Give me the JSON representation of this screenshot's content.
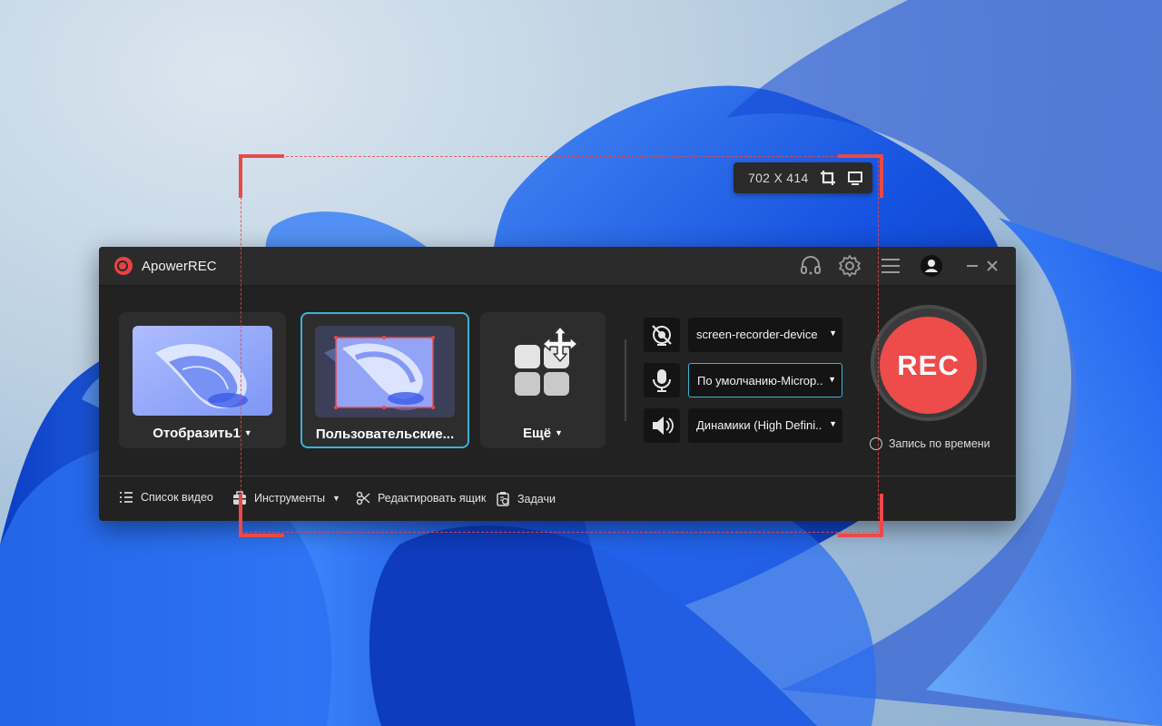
{
  "selection": {
    "dimensions": "702 X 414",
    "crop_icon": "crop-icon",
    "fullscreen_icon": "monitor-icon"
  },
  "app": {
    "title": "ApowerREC",
    "titlebar_icons": [
      "headset-icon",
      "gear-icon",
      "menu-icon",
      "avatar-icon",
      "minimize-icon",
      "close-icon"
    ]
  },
  "modes": {
    "display": {
      "label": "Отобразить1"
    },
    "custom": {
      "label": "Пользовательские..."
    },
    "more": {
      "label": "Ещё"
    }
  },
  "sources": {
    "camera": {
      "value": "screen-recorder-device",
      "icon": "camera-off-icon"
    },
    "microphone": {
      "value": "По умолчанию-Microp...",
      "icon": "microphone-icon"
    },
    "speaker": {
      "value": "Динамики (High Defini...",
      "icon": "speaker-icon"
    }
  },
  "rec": {
    "button_label": "REC",
    "timed_label": "Запись по времени"
  },
  "bottom": {
    "video_list": "Список видео",
    "tools": "Инструменты",
    "edit_box": "Редактировать ящик",
    "tasks": "Задачи"
  },
  "colors": {
    "accent": "#39b3d6",
    "rec_red": "#ee4b4b",
    "selection_red": "#e84a4a"
  }
}
